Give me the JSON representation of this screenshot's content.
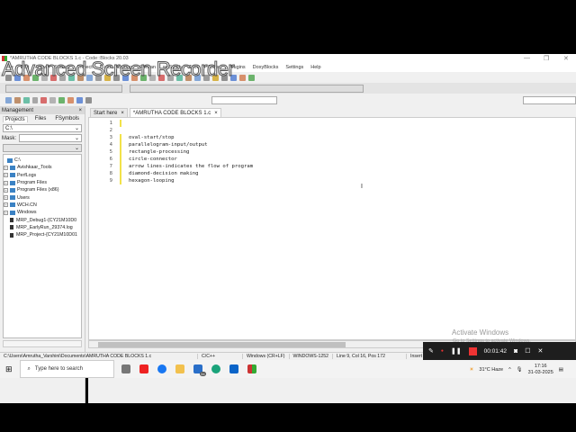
{
  "window": {
    "title": "*AMRUTHA CODE BLOCKS 1.c - Code::Blocks 20.03"
  },
  "watermark": "Advanced Screen Recorder",
  "menu": [
    "File",
    "Edit",
    "View",
    "Search",
    "Project",
    "Build",
    "Debug",
    "Fortran",
    "wxSmith",
    "Tools",
    "Tools+",
    "Plugins",
    "DoxyBlocks",
    "Settings",
    "Help"
  ],
  "management": {
    "title": "Management",
    "close": "×",
    "tabs": [
      "Projects",
      "Files",
      "FSymbols"
    ],
    "path": "C:\\",
    "mask_label": "Mask:",
    "mask_value": ""
  },
  "tree": {
    "root": "C:\\",
    "folders": [
      "Avishkaar_Tools",
      "PerfLogs",
      "Program Files",
      "Program Files (x86)",
      "Users",
      "WCH.CN",
      "Windows"
    ],
    "files": [
      "MRP_Debug1-{CY21M10D0",
      "MRP_EarlyRun_29374.log",
      "MRP_Project-{CY21M10D01"
    ]
  },
  "editor": {
    "tabs": [
      {
        "label": "Start here",
        "close": "×"
      },
      {
        "label": "*AMRUTHA CODE BLOCKS 1.c",
        "close": "×"
      }
    ],
    "lines": [
      "",
      "",
      "oval-start/stop",
      "parallelogram-input/output",
      "rectangle-processing",
      "circle-connector",
      "arrow lines-indicates the flow of program",
      "diamond-decision making",
      "hexagon-looping"
    ]
  },
  "status": {
    "path": "C:\\Users\\Amrutha_Varshini\\Documents\\AMRUTHA CODE BLOCKS 1.c",
    "language": "C/C++",
    "line_endings": "Windows (CR+LF)",
    "encoding": "WINDOWS-1252",
    "position": "Line 9, Col 16, Pos 172",
    "mode": "Insert"
  },
  "taskbar": {
    "search_placeholder": "Type here to search",
    "mail_badge": "34",
    "weather": "31°C  Haze",
    "time": "17:16",
    "date": "31-03-2025"
  },
  "recorder": {
    "elapsed": "00:01:42"
  },
  "activate": {
    "title": "Activate Windows",
    "subtitle": "Go to Settings to activate Windows."
  }
}
